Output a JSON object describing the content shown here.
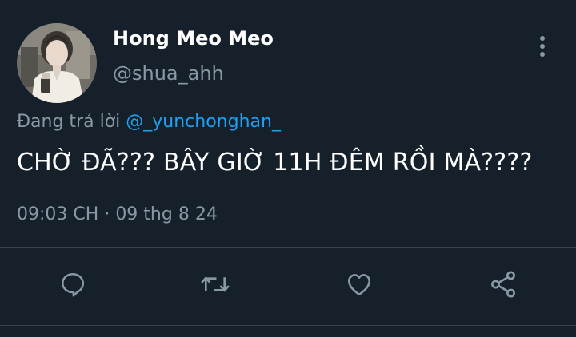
{
  "tweet": {
    "display_name": "Hong Meo Meo",
    "handle": "@shua_ahh",
    "reply_prefix": "Đang trả lời",
    "reply_to": "@_yunchonghan_",
    "text": "CHỜ ĐÃ??? BÂY GIỜ 11H ĐÊM RỒI MÀ????",
    "time": "09:03 CH",
    "separator": "·",
    "date": "09 thg 8 24"
  },
  "icons": {
    "more": "more-vertical-icon",
    "reply": "reply-icon",
    "retweet": "retweet-icon",
    "like": "heart-icon",
    "share": "share-icon"
  },
  "colors": {
    "background": "#15202b",
    "primary_text": "#ffffff",
    "secondary_text": "#8899a6",
    "link": "#1da1f2",
    "divider": "#38444d"
  }
}
